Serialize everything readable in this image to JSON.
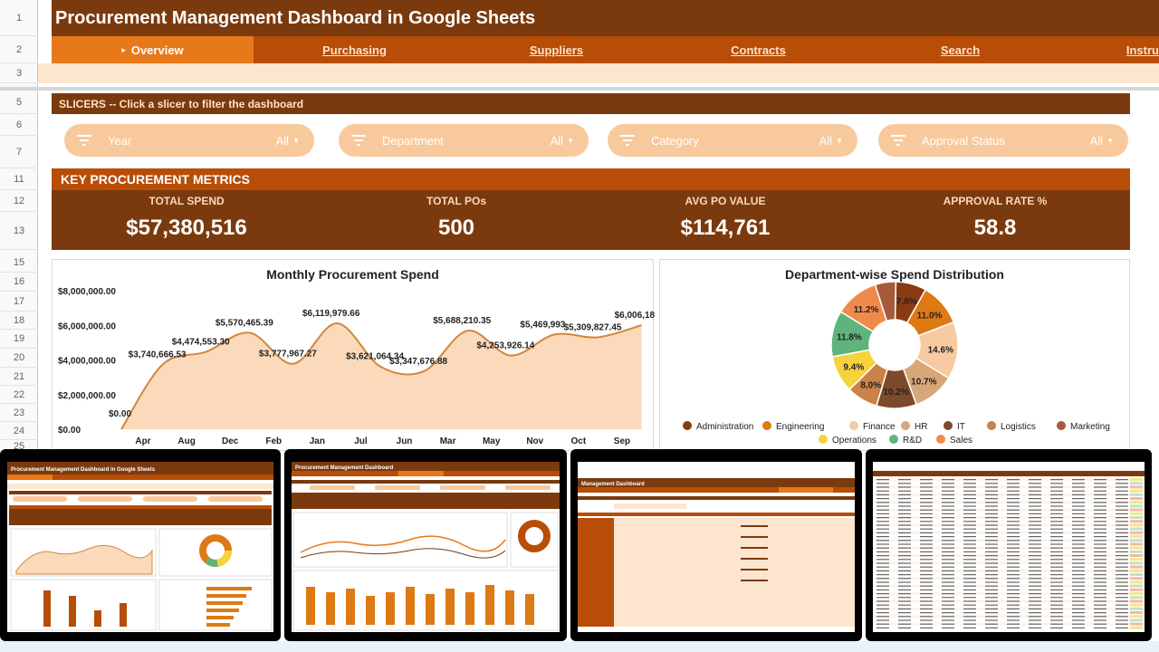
{
  "row_numbers": [
    "1",
    "2",
    "3",
    "5",
    "6",
    "7",
    "11",
    "12",
    "13",
    "15",
    "16",
    "17",
    "18",
    "19",
    "20",
    "21",
    "22",
    "23",
    "24",
    "25"
  ],
  "title": "Procurement Management Dashboard in Google Sheets",
  "nav": {
    "tabs": [
      {
        "label": "Overview",
        "active": true
      },
      {
        "label": "Purchasing",
        "active": false
      },
      {
        "label": "Suppliers",
        "active": false
      },
      {
        "label": "Contracts",
        "active": false
      },
      {
        "label": "Search",
        "active": false
      },
      {
        "label": "Instru",
        "active": false
      }
    ]
  },
  "slicers": {
    "header": "SLICERS -- Click a slicer to filter the dashboard",
    "items": [
      {
        "label": "Year",
        "value": "All"
      },
      {
        "label": "Department",
        "value": "All"
      },
      {
        "label": "Category",
        "value": "All"
      },
      {
        "label": "Approval Status",
        "value": "All"
      }
    ]
  },
  "metrics": {
    "header": "KEY PROCUREMENT METRICS",
    "items": [
      {
        "label": "TOTAL SPEND",
        "value": "$57,380,516"
      },
      {
        "label": "TOTAL POs",
        "value": "500"
      },
      {
        "label": "AVG PO VALUE",
        "value": "$114,761"
      },
      {
        "label": "APPROVAL RATE %",
        "value": "58.8"
      }
    ]
  },
  "colors": {
    "dark_brown": "#7b3a0e",
    "orange": "#b84d08",
    "active_tab": "#e8791a",
    "slicer_fill": "#f8c99c",
    "area_fill": "#fbd9bb",
    "area_line": "#d2873a"
  },
  "chart_data": [
    {
      "type": "area",
      "title": "Monthly Procurement Spend",
      "x": [
        "Apr",
        "Aug",
        "Dec",
        "Feb",
        "Jan",
        "Jul",
        "Jun",
        "Mar",
        "May",
        "Nov",
        "Oct",
        "Sep"
      ],
      "values": [
        3740666.53,
        4474553.3,
        5570465.39,
        3777967.27,
        6119979.66,
        3621064.34,
        3347676.88,
        5688210.35,
        4253926.14,
        5469993,
        5309827.45,
        6006180
      ],
      "data_labels": [
        "$3,740,666.53",
        "$4,474,553.30",
        "$5,570,465.39",
        "$3,777,967.27",
        "$6,119,979.66",
        "$3,621,064.34",
        "$3,347,676.88",
        "$5,688,210.35",
        "$4,253,926.14",
        "$5,469,993",
        "$5,309,827.45",
        "$6,006,18"
      ],
      "start_label": "$0.00",
      "y_ticks": [
        "$0.00",
        "$2,000,000.00",
        "$4,000,000.00",
        "$6,000,000.00",
        "$8,000,000.00"
      ],
      "ylim": [
        0,
        8000000
      ]
    },
    {
      "type": "pie",
      "title": "Department-wise Spend Distribution",
      "slices": [
        {
          "name": "Administration",
          "value": 7.8,
          "label": "7.8%",
          "color": "#8b3a12"
        },
        {
          "name": "Engineering",
          "value": 11.0,
          "label": "11.0%",
          "color": "#dd7a14"
        },
        {
          "name": "Finance",
          "value": 14.6,
          "label": "14.6%",
          "color": "#f7caa1"
        },
        {
          "name": "HR",
          "value": 10.7,
          "label": "10.7%",
          "color": "#d7a77a"
        },
        {
          "name": "IT",
          "value": 10.2,
          "label": "10.2%",
          "color": "#7e4a2c"
        },
        {
          "name": "Logistics",
          "value": 8.0,
          "label": "8.0%",
          "color": "#cc8148"
        },
        {
          "name": "Marketing",
          "value": 9.4,
          "label": "9.4%",
          "color": "#f6d23c"
        },
        {
          "name": "Operations",
          "value": 11.8,
          "label": "11.8%",
          "color": "#5fb37c"
        },
        {
          "name": "R&D",
          "value": 11.2,
          "label": "11.2%",
          "color": "#f08a4b"
        },
        {
          "name": "Sales",
          "value": 5.3,
          "label": "",
          "color": "#a65a3c"
        }
      ],
      "legend": [
        {
          "name": "Administration",
          "color": "#8b3a12"
        },
        {
          "name": "Engineering",
          "color": "#dd7a14"
        },
        {
          "name": "Finance",
          "color": "#f7caa1"
        },
        {
          "name": "HR",
          "color": "#d7a77a"
        },
        {
          "name": "IT",
          "color": "#7e4a2c"
        },
        {
          "name": "Logistics",
          "color": "#cc8148"
        },
        {
          "name": "Marketing",
          "color": "#a65a3c"
        },
        {
          "name": "Operations",
          "color": "#f6d23c"
        },
        {
          "name": "R&D",
          "color": "#5fb37c"
        },
        {
          "name": "Sales",
          "color": "#f08a4b"
        }
      ],
      "legend_position": "bottom"
    }
  ],
  "thumbnails": [
    {
      "title": "Procurement Management Dashboard in Google Sheets"
    },
    {
      "title": "Procurement Management Dashboard"
    },
    {
      "title": "Management Dashboard"
    },
    {
      "title": ""
    }
  ]
}
